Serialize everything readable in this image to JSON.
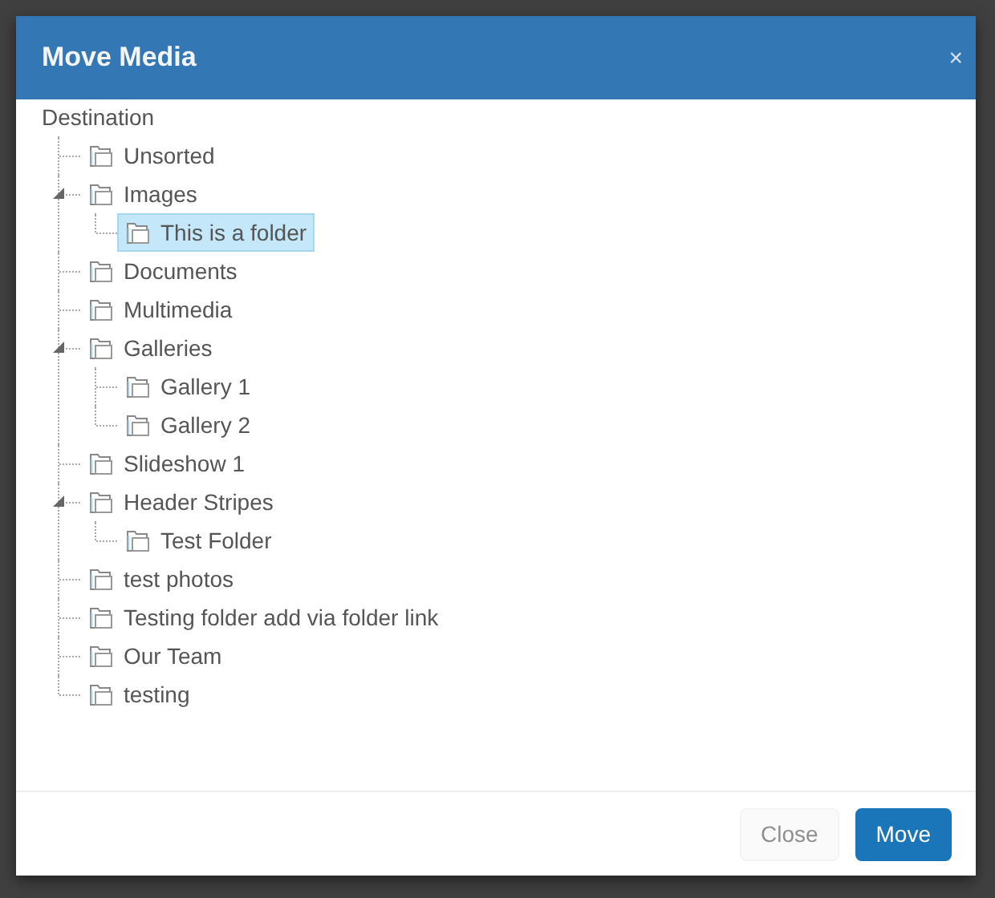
{
  "dialog": {
    "title": "Move Media",
    "close_symbol": "×"
  },
  "destination_label": "Destination",
  "tree": [
    {
      "label": "Unsorted",
      "selected": false
    },
    {
      "label": "Images",
      "selected": false,
      "expanded": true,
      "children": [
        {
          "label": "This is a folder",
          "selected": true
        }
      ]
    },
    {
      "label": "Documents",
      "selected": false
    },
    {
      "label": "Multimedia",
      "selected": false
    },
    {
      "label": "Galleries",
      "selected": false,
      "expanded": true,
      "children": [
        {
          "label": "Gallery 1",
          "selected": false
        },
        {
          "label": "Gallery 2",
          "selected": false
        }
      ]
    },
    {
      "label": "Slideshow 1",
      "selected": false
    },
    {
      "label": "Header Stripes",
      "selected": false,
      "expanded": true,
      "children": [
        {
          "label": "Test Folder",
          "selected": false
        }
      ]
    },
    {
      "label": "test photos",
      "selected": false
    },
    {
      "label": "Testing folder add via folder link",
      "selected": false
    },
    {
      "label": "Our Team",
      "selected": false
    },
    {
      "label": "testing",
      "selected": false
    }
  ],
  "buttons": [
    {
      "label": "Close",
      "kind": "secondary",
      "disabled": true
    },
    {
      "label": "Move",
      "kind": "primary",
      "disabled": false
    }
  ]
}
